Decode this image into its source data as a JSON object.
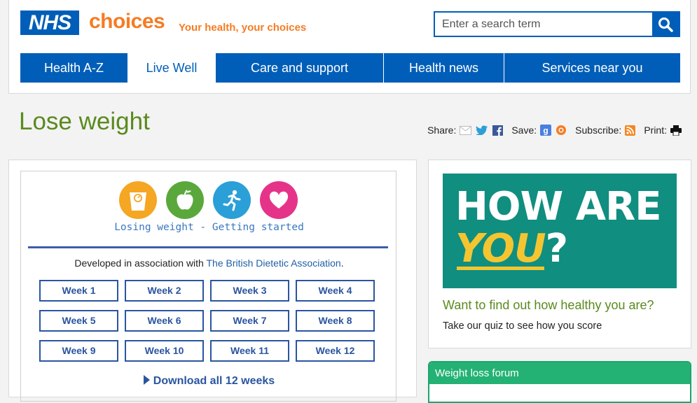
{
  "header": {
    "logo": "NHS",
    "brand": "choices",
    "tagline": "Your health, your choices",
    "search_placeholder": "Enter a search term"
  },
  "nav": {
    "items": [
      {
        "label": "Health A-Z"
      },
      {
        "label": "Live Well"
      },
      {
        "label": "Care and support"
      },
      {
        "label": "Health news"
      },
      {
        "label": "Services near you"
      }
    ],
    "active": "Live Well"
  },
  "page": {
    "title": "Lose weight"
  },
  "share": {
    "share_label": "Share:",
    "save_label": "Save:",
    "subscribe_label": "Subscribe:",
    "print_label": "Print:"
  },
  "plan": {
    "icons": [
      "scales-icon",
      "apple-icon",
      "runner-icon",
      "heart-icon"
    ],
    "icon_colors": [
      "#f5a623",
      "#5aa83c",
      "#2a9fd8",
      "#e6338a"
    ],
    "heading": "Losing weight - Getting started",
    "developed_prefix": "Developed in association with ",
    "developed_link": "The British Dietetic Association",
    "developed_suffix": ".",
    "weeks": [
      "Week 1",
      "Week 2",
      "Week 3",
      "Week 4",
      "Week 5",
      "Week 6",
      "Week 7",
      "Week 8",
      "Week 9",
      "Week 10",
      "Week 11",
      "Week 12"
    ],
    "download": "Download all 12 weeks"
  },
  "promo": {
    "banner_line1": "HOW ARE",
    "banner_you": "YOU",
    "banner_q": "?",
    "title": "Want to find out how healthy you are?",
    "subtitle": "Take our quiz to see how you score"
  },
  "forum": {
    "title": "Weight loss forum"
  },
  "colors": {
    "nhs_blue": "#005eb8",
    "choices_orange": "#f57c24",
    "title_green": "#5a8a1e",
    "banner_teal": "#108e80",
    "forum_green": "#23b274"
  }
}
